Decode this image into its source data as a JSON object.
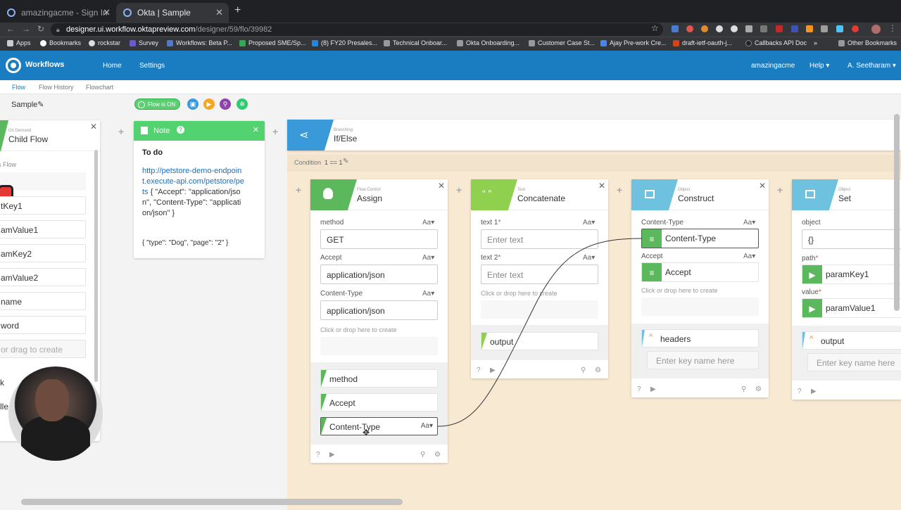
{
  "browser": {
    "tabs": [
      {
        "title": "amazingacme - Sign In"
      },
      {
        "title": "Okta | Sample"
      }
    ],
    "url_host": "designer.ui.workflow.oktapreview.com",
    "url_path": "/designer/59/flo/39982",
    "bookmarks": [
      "Apps",
      "Bookmarks",
      "rockstar",
      "Survey",
      "Workflows: Beta P...",
      "Proposed SME/Sp...",
      "(8) FY20 Presales...",
      "Technical Onboar...",
      "Okta Onboarding...",
      "Customer Case St...",
      "Ajay Pre-work Cre...",
      "draft-ietf-oauth-j...",
      "Callbacks API Doc",
      "»",
      "Other Bookmarks"
    ]
  },
  "app": {
    "title": "Workflows",
    "nav": [
      "Home",
      "Settings"
    ],
    "org": "amazingacme",
    "help": "Help ▾",
    "user": "A. Seetharam ▾",
    "subnav": [
      "Flow",
      "Flow History",
      "Flowchart"
    ],
    "flow_name": "Sample",
    "flow_status": "Flow is ON",
    "accent": "#1a7cc1"
  },
  "child_flow": {
    "category": "On Demand",
    "title": "Child Flow",
    "section": "his Flow",
    "items": [
      "tKey1",
      "amValue1",
      "amKey2",
      "amValue2",
      "name",
      "word",
      "or drag to create",
      "k",
      "lle"
    ]
  },
  "note": {
    "header": "Note",
    "title": "To do",
    "link": "http://petstore-demo-endpoint.execute-api.com/petstore/pets",
    "body": "{ \"Accept\": \"application/json\", \"Content-Type\": \"application/json\" }",
    "body2": "{ \"type\": \"Dog\", \"page\": \"2\" }"
  },
  "branching": {
    "category": "Branching",
    "title": "If/Else",
    "condition_label": "Condition",
    "condition_value": "1 == 1"
  },
  "assign": {
    "category": "Flow Control",
    "title": "Assign",
    "fields": [
      {
        "label": "method",
        "value": "GET"
      },
      {
        "label": "Accept",
        "value": "application/json"
      },
      {
        "label": "Content-Type",
        "value": "application/json"
      }
    ],
    "hint": "Click or drop here to create",
    "outputs": [
      "method",
      "Accept",
      "Content-Type"
    ]
  },
  "concatenate": {
    "category": "Text",
    "title": "Concatenate",
    "fields": [
      {
        "label": "text 1",
        "placeholder": "Enter text"
      },
      {
        "label": "text 2",
        "placeholder": "Enter text"
      }
    ],
    "hint": "Click or drop here to create",
    "output": "output"
  },
  "construct": {
    "category": "Object",
    "title": "Construct",
    "fields": [
      {
        "label": "Content-Type",
        "value": "Content-Type"
      },
      {
        "label": "Accept",
        "value": "Accept"
      }
    ],
    "hint": "Click or drop here to create",
    "output": "headers",
    "key_placeholder": "Enter key name here"
  },
  "set": {
    "category": "Object",
    "title": "Set",
    "fields": [
      {
        "label": "object",
        "value": "{}"
      },
      {
        "label": "path",
        "value": "paramKey1"
      },
      {
        "label": "value",
        "value": "paramValue1"
      }
    ],
    "output": "output",
    "key_placeholder": "Enter key name here"
  },
  "aa": "Aa▾"
}
